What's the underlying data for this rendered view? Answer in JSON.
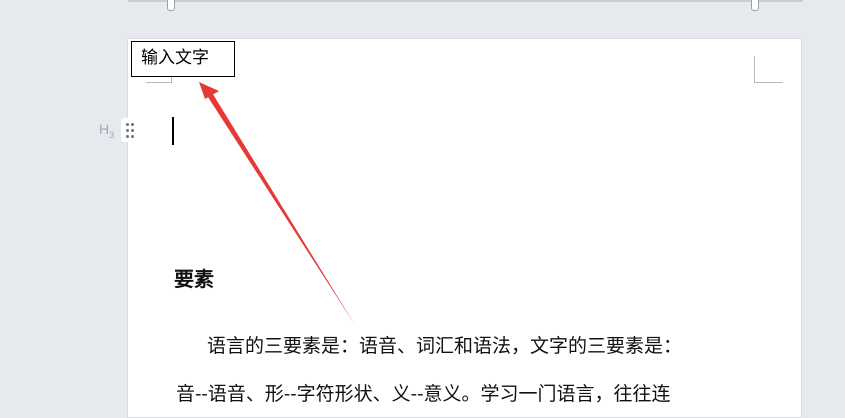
{
  "callout": {
    "text": "输入文字"
  },
  "heading_tag": {
    "letter": "H",
    "level": "3"
  },
  "document": {
    "section_title": "要素",
    "paragraph_lines": [
      "语言的三要素是：语音、词汇和语法，文字的三要素是：",
      "音--语音、形--字符形状、义--意义。学习一门语言，往往连"
    ]
  },
  "colors": {
    "arrow": "#e53935",
    "background": "#e6e9ee",
    "page": "#ffffff"
  }
}
